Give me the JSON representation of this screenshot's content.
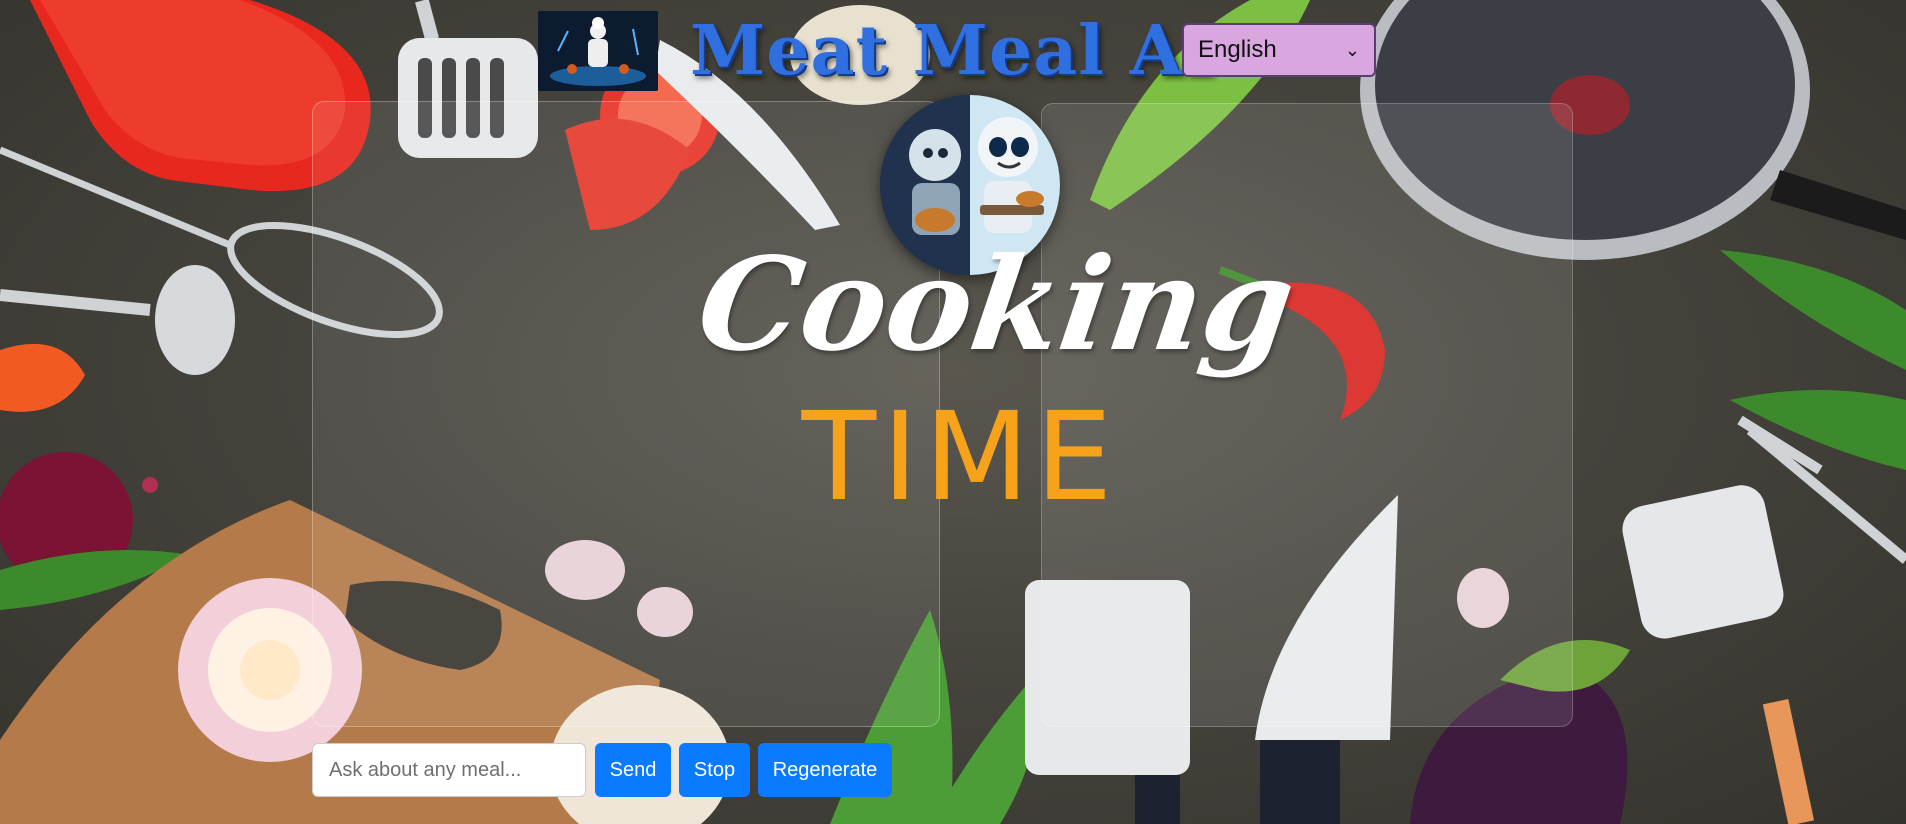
{
  "header": {
    "title": "Meat Meal AI",
    "logo_icon": "chef-logo-icon",
    "language": {
      "selected": "English"
    }
  },
  "hero": {
    "line1": "Cooking",
    "line2": "TIME"
  },
  "chat": {
    "placeholder": "Ask about any meal...",
    "value": "",
    "send_label": "Send",
    "stop_label": "Stop",
    "regenerate_label": "Regenerate"
  },
  "colors": {
    "title_blue": "#2f6fe0",
    "button_blue": "#0a7bff",
    "select_bg": "#d9a6e0",
    "time_orange": "#f7a21b"
  }
}
